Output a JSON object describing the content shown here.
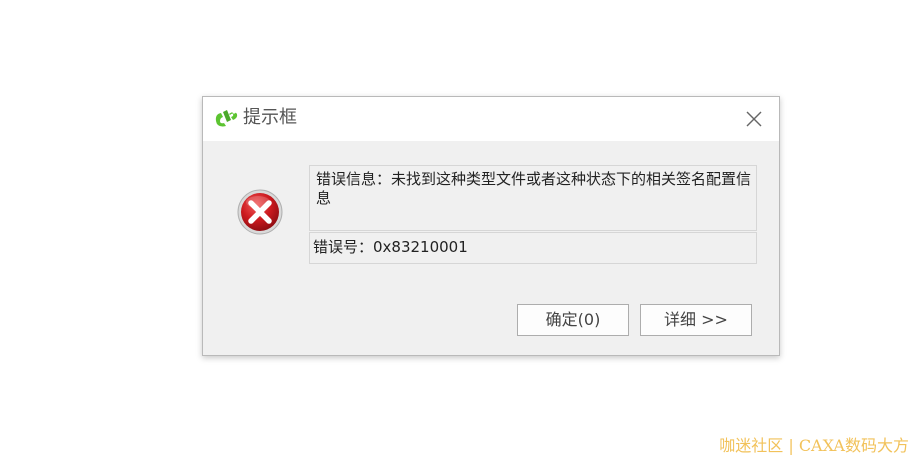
{
  "dialog": {
    "title": "提示框",
    "close_icon": "close-icon",
    "app_icon": "caxa-logo-icon",
    "error_icon": "error-x-icon",
    "message": "错误信息：未找到这种类型文件或者这种状态下的相关签名配置信息",
    "error_code": "错误号：0x83210001",
    "ok_label": "确定(0)",
    "detail_label": "详细 >>"
  },
  "watermark": {
    "text": "咖迷社区 | CAXA数码大方"
  },
  "colors": {
    "dialog_bg": "#f0f0f0",
    "titlebar_bg": "#ffffff",
    "error_red": "#c8171e",
    "logo_green": "#5cc431",
    "watermark": "#f2c25a"
  }
}
